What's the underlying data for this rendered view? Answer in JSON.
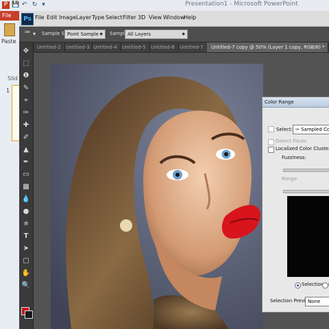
{
  "powerpoint": {
    "window_title": "Presentation1 - Microsoft PowerPoint",
    "file_tab": "File",
    "paste_label": "Paste",
    "slides_label": "Slid",
    "slide_number": "1",
    "accent_color": "#c8402a"
  },
  "photoshop": {
    "logo": "Ps",
    "menu": [
      "File",
      "Edit",
      "Image",
      "Layer",
      "Type",
      "Select",
      "Filter",
      "3D",
      "View",
      "Window",
      "Help"
    ],
    "options_bar": {
      "sample_size_label": "Sample Size:",
      "sample_size_value": "Point Sample",
      "sample_label": "Sample:",
      "sample_value": "All Layers"
    },
    "tabs": [
      "Untitled-2",
      "Untitled-3",
      "Untitled-4",
      "Untitled-5",
      "Untitled-6",
      "Untitled-7",
      "Untitled-7 copy @ 50% (Layer 1 copy, RGB/8) *"
    ],
    "active_tab_index": 6,
    "tools": [
      "move-icon",
      "marquee-icon",
      "lasso-icon",
      "quick-selection-icon",
      "crop-icon",
      "eyedropper-icon",
      "healing-brush-icon",
      "brush-icon",
      "clone-stamp-icon",
      "history-brush-icon",
      "eraser-icon",
      "gradient-icon",
      "blur-icon",
      "dodge-icon",
      "pen-icon",
      "type-icon",
      "path-selection-icon",
      "rectangle-icon",
      "hand-icon",
      "zoom-icon"
    ],
    "foreground_color": "#c8161b",
    "background_color": "#1a1a1a"
  },
  "color_range": {
    "title": "Color Range",
    "select_label": "Select:",
    "select_value": "Sampled Colors",
    "detect_faces": "Detect Faces",
    "localized_clusters": "Localized Color Clusters",
    "fuzziness_label": "Fuzziness:",
    "range_label": "Range",
    "selection_radio": "Selection",
    "image_radio": "I",
    "preview_label": "Selection Preview:",
    "preview_value": "None"
  }
}
